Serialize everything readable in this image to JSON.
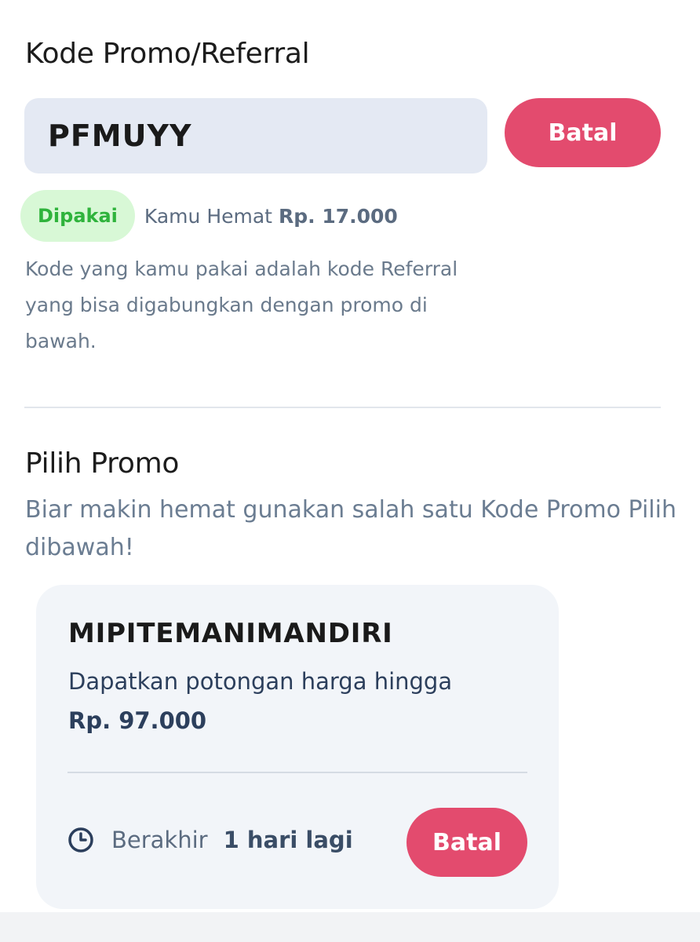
{
  "referral": {
    "title": "Kode Promo/Referral",
    "code_value": "PFMUYY",
    "cancel_label": "Batal",
    "status_badge": "Dipakai",
    "saved_label": "Kamu Hemat",
    "saved_amount": "Rp. 17.000",
    "description": "Kode yang kamu pakai adalah kode Referral yang bisa digabungkan dengan promo di bawah."
  },
  "promo": {
    "title": "Pilih Promo",
    "description": "Biar makin hemat gunakan salah satu Kode Promo Pilih dibawah!",
    "cards": [
      {
        "code": "MIPITEMANIMANDIRI",
        "offer_text": "Dapatkan potongan harga hingga",
        "offer_amount": "Rp. 97.000",
        "expiry_label": "Berakhir",
        "expiry_value": "1 hari lagi",
        "cancel_label": "Batal",
        "icon": "clock-icon"
      }
    ]
  },
  "colors": {
    "accent": "#e34b6e",
    "badge_bg": "#d8f8d6",
    "badge_text": "#2fb33c",
    "input_bg": "#e4e9f3",
    "card_bg": "#f2f5f9"
  }
}
